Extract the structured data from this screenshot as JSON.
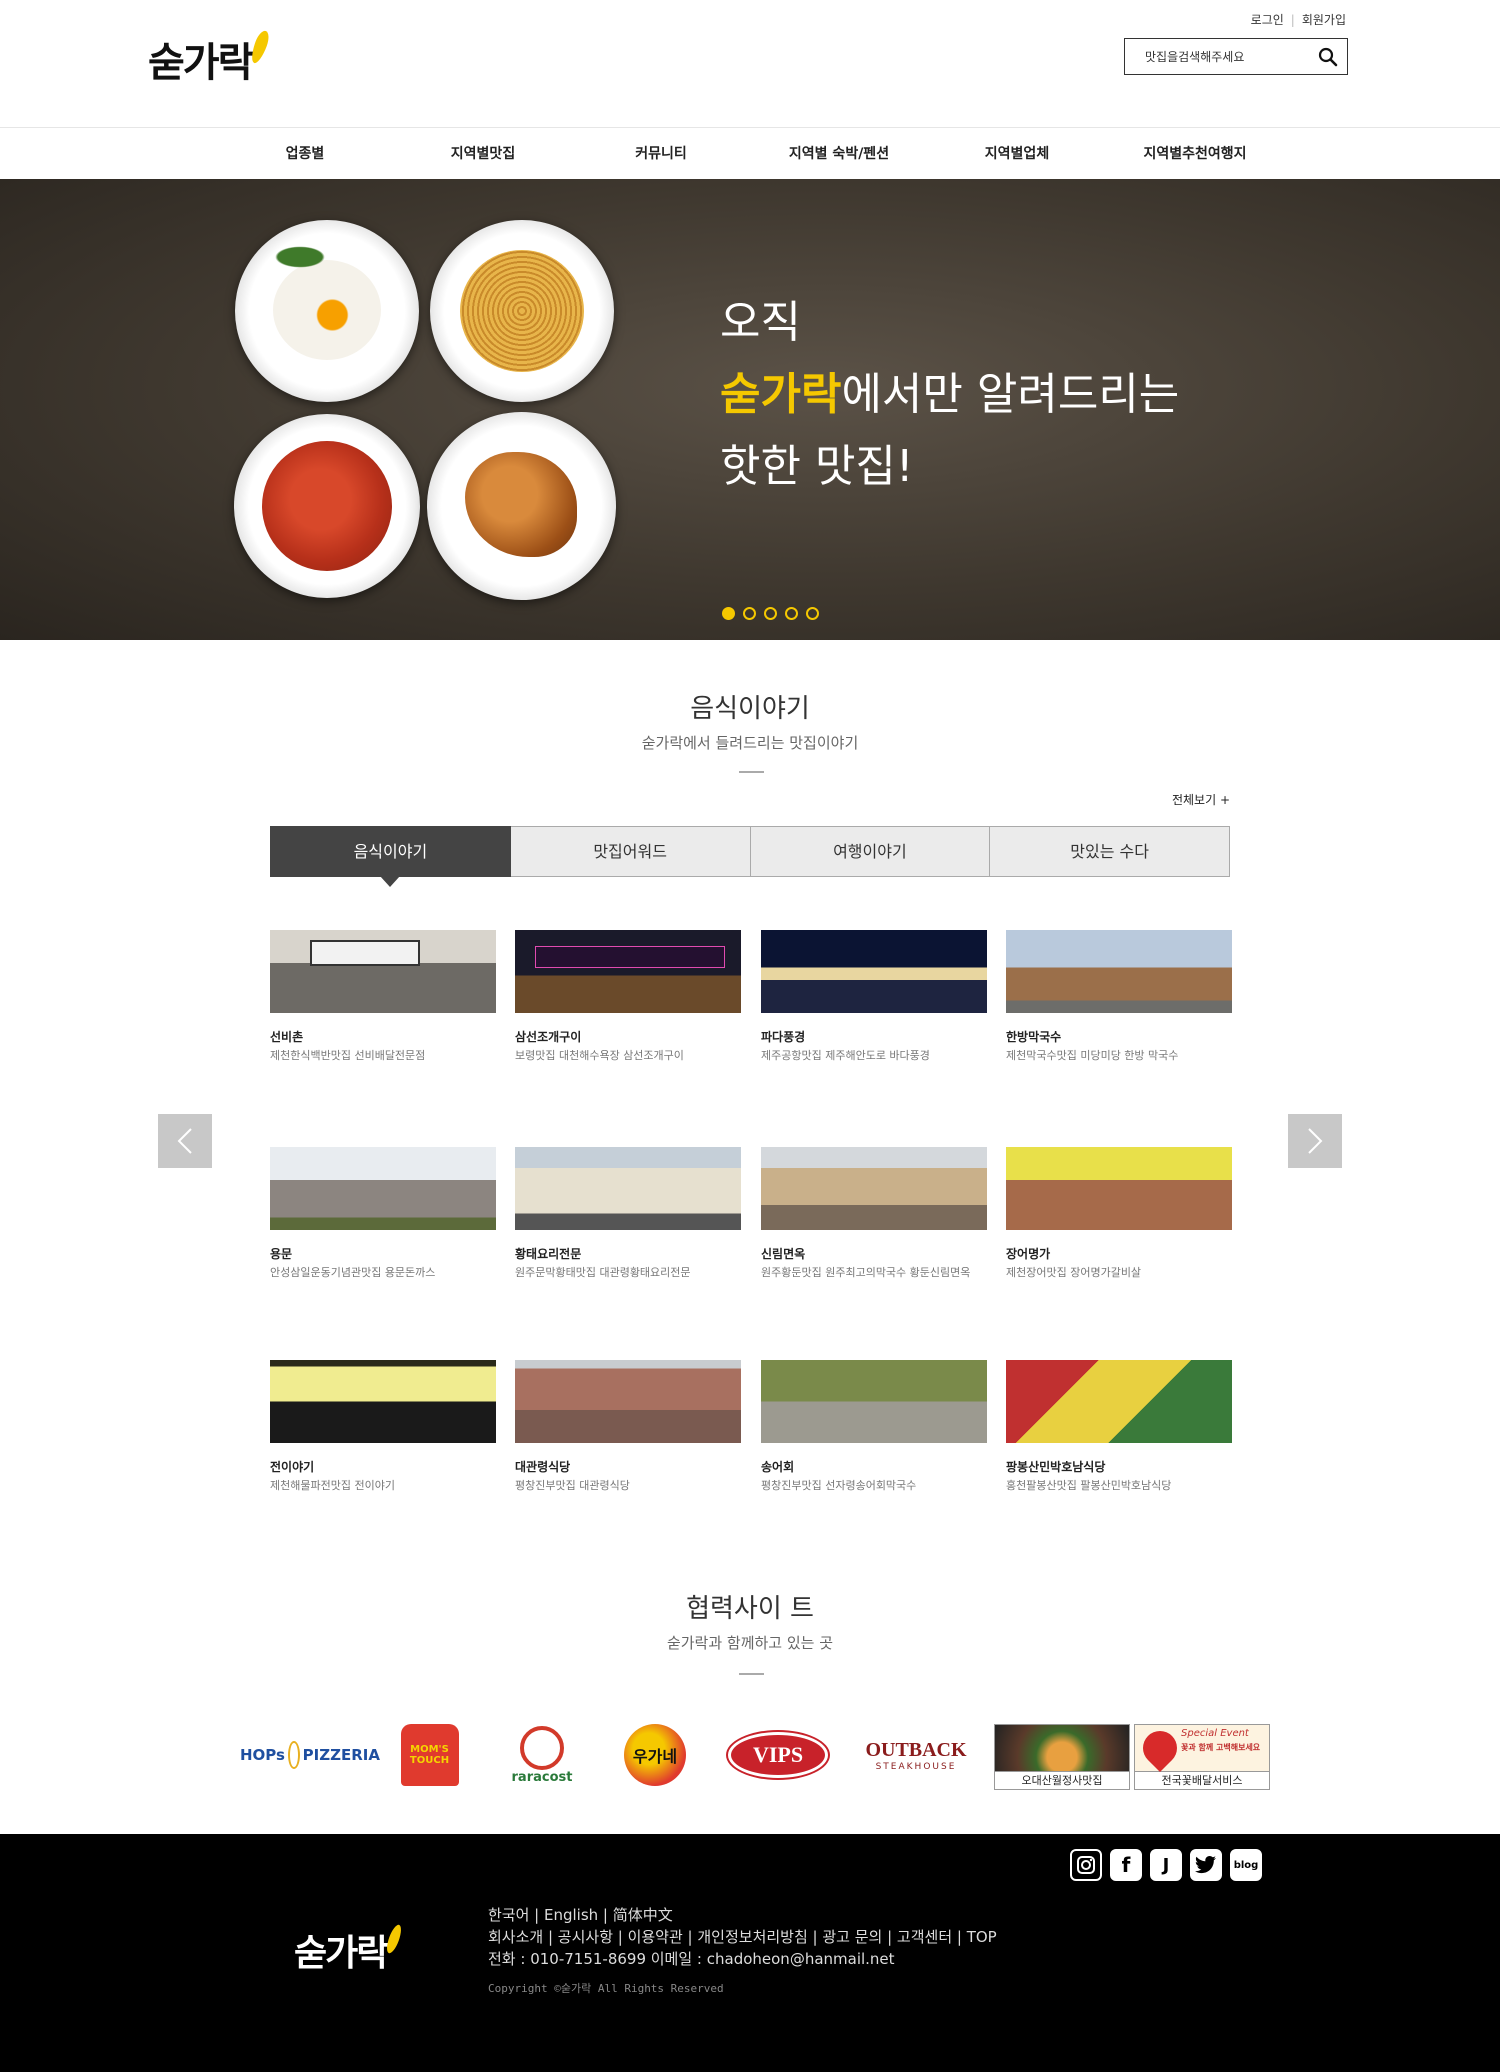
{
  "header": {
    "logo": "숟가락",
    "login": "로그인",
    "signup": "회원가입",
    "search_placeholder": "맛집을검색해주세요"
  },
  "nav": [
    "업종별",
    "지역별맛집",
    "커뮤니티",
    "지역별 숙박/펜션",
    "지역별업체",
    "지역별추천여행지"
  ],
  "banner": {
    "line1": "오직",
    "highlight": "숟가락",
    "line2_rest": "에서만 알려드리는",
    "line3": "핫한 맛집!",
    "slides": 5,
    "active_slide": 1
  },
  "food_story": {
    "title": "음식이야기",
    "subtitle": "숟가락에서 들려드리는 맛집이야기",
    "view_all": "전체보기 +",
    "tabs": [
      "음식이야기",
      "맛집어워드",
      "여행이야기",
      "맛있는 수다"
    ],
    "active_tab": 0,
    "items": [
      {
        "name": "선비촌",
        "desc": "제천한식백반맛집 선비배달전문점"
      },
      {
        "name": "삼선조개구이",
        "desc": "보령맛집 대천해수욕장 삼선조개구이"
      },
      {
        "name": "파다풍경",
        "desc": "제주공항맛집 제주해안도로 바다풍경"
      },
      {
        "name": "한방막국수",
        "desc": "제천막국수맛집 미당미당 한방 막국수"
      },
      {
        "name": "용문",
        "desc": "안성삼일운동기념관맛집 용문돈까스"
      },
      {
        "name": "황태요리전문",
        "desc": "원주문막황태맛집 대관령황태요리전문"
      },
      {
        "name": "신림면옥",
        "desc": "원주황둔맛집 원주최고의막국수 황둔신림면옥"
      },
      {
        "name": "장어명가",
        "desc": "제천장어맛집 장어명가갈비살"
      },
      {
        "name": "전이야기",
        "desc": "제천해물파전맛집 전이야기"
      },
      {
        "name": "대관령식당",
        "desc": "평창진부맛집 대관령식당"
      },
      {
        "name": "송어회",
        "desc": "평창진부맛집 선자령송어회막국수"
      },
      {
        "name": "팡봉산민박호남식당",
        "desc": "홍천팔봉산맛집 팔봉산민박호남식당"
      }
    ]
  },
  "partners": {
    "title": "협력사이 트",
    "subtitle": "숟가락과 함께하고 있는 곳",
    "logos": {
      "hops": "HOPs",
      "hops2": "PIZZERIA",
      "moms": "MOM'S TOUCH",
      "raracost": "raracost",
      "ugane": "우가네",
      "vips": "VIPS",
      "outback": "OUTBACK",
      "outback_sub": "STEAKHOUSE",
      "box1": "오대산월정사맛집",
      "box2": "전국꽃배달서비스",
      "box2_top": "Special Event",
      "box2_mid": "꽃과 함께 고백해보세요"
    }
  },
  "footer": {
    "logo": "숟가락",
    "langs": "한국어  | English  | 简体中文",
    "links": "회사소개 | 공시사항 | 이용약관 | 개인정보처리방침 | 광고 문의 | 고객센터 | TOP",
    "contact": "전화 : 010-7151-8699  이메일 : chadoheon@hanmail.net",
    "copyright": "Copyright ©숟가락  All Rights Reserved",
    "blog": "blog"
  }
}
